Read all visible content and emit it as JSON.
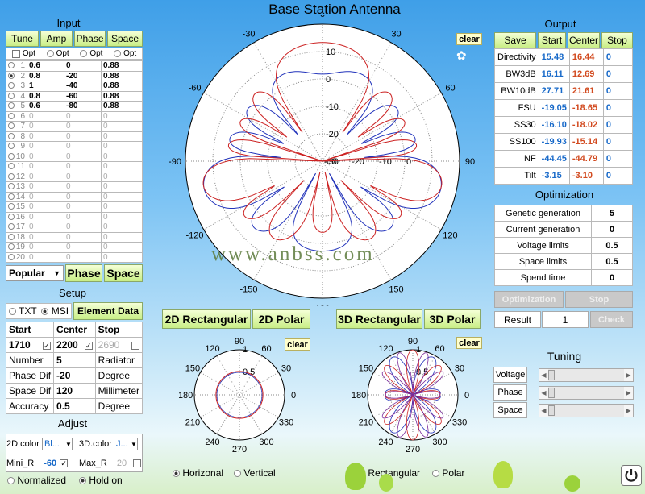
{
  "main_title": "Base Station Antenna",
  "watermark": "www.anbss.com",
  "input": {
    "title": "Input",
    "buttons": [
      "Tune",
      "Amp",
      "Phase",
      "Space"
    ],
    "opt_label": "Opt",
    "rows": [
      {
        "n": "1",
        "amp": "0.6",
        "phase": "0",
        "space": "0.88",
        "active": true
      },
      {
        "n": "2",
        "amp": "0.8",
        "phase": "-20",
        "space": "0.88",
        "active": true
      },
      {
        "n": "3",
        "amp": "1",
        "phase": "-40",
        "space": "0.88",
        "active": true
      },
      {
        "n": "4",
        "amp": "0.8",
        "phase": "-60",
        "space": "0.88",
        "active": true
      },
      {
        "n": "5",
        "amp": "0.6",
        "phase": "-80",
        "space": "0.88",
        "active": true
      },
      {
        "n": "6",
        "amp": "0",
        "phase": "0",
        "space": "0",
        "active": false
      },
      {
        "n": "7",
        "amp": "0",
        "phase": "0",
        "space": "0",
        "active": false
      },
      {
        "n": "8",
        "amp": "0",
        "phase": "0",
        "space": "0",
        "active": false
      },
      {
        "n": "9",
        "amp": "0",
        "phase": "0",
        "space": "0",
        "active": false
      },
      {
        "n": "10",
        "amp": "0",
        "phase": "0",
        "space": "0",
        "active": false
      },
      {
        "n": "11",
        "amp": "0",
        "phase": "0",
        "space": "0",
        "active": false
      },
      {
        "n": "12",
        "amp": "0",
        "phase": "0",
        "space": "0",
        "active": false
      },
      {
        "n": "13",
        "amp": "0",
        "phase": "0",
        "space": "0",
        "active": false
      },
      {
        "n": "14",
        "amp": "0",
        "phase": "0",
        "space": "0",
        "active": false
      },
      {
        "n": "15",
        "amp": "0",
        "phase": "0",
        "space": "0",
        "active": false
      },
      {
        "n": "16",
        "amp": "0",
        "phase": "0",
        "space": "0",
        "active": false
      },
      {
        "n": "17",
        "amp": "0",
        "phase": "0",
        "space": "0",
        "active": false
      },
      {
        "n": "18",
        "amp": "0",
        "phase": "0",
        "space": "0",
        "active": false
      },
      {
        "n": "19",
        "amp": "0",
        "phase": "0",
        "space": "0",
        "active": false
      },
      {
        "n": "20",
        "amp": "0",
        "phase": "0",
        "space": "0",
        "active": false
      }
    ],
    "preset": "Popular",
    "phase_btn": "Phase",
    "space_btn": "Space"
  },
  "setup": {
    "title": "Setup",
    "txt": "TXT",
    "msi": "MSI",
    "element_data": "Element Data",
    "headers": [
      "Start",
      "Center",
      "Stop"
    ],
    "freq": [
      "1710",
      "2200",
      "2690"
    ],
    "params": [
      {
        "label": "Number",
        "value": "5",
        "unit": "Radiator"
      },
      {
        "label": "Phase Dif",
        "value": "-20",
        "unit": "Degree"
      },
      {
        "label": "Space Dif",
        "value": "120",
        "unit": "Millimeter"
      },
      {
        "label": "Accuracy",
        "value": "0.5",
        "unit": "Degree"
      }
    ]
  },
  "adjust": {
    "title": "Adjust",
    "color2d_label": "2D.color",
    "color2d": "Bl...",
    "color3d_label": "3D.color",
    "color3d": "J...",
    "mini_label": "Mini_R",
    "mini": "-60",
    "max_label": "Max_R",
    "max": "20",
    "normalized": "Normalized",
    "hold": "Hold on"
  },
  "main_polar": {
    "clear": "clear",
    "angles": [
      "0",
      "30",
      "60",
      "90",
      "120",
      "150",
      "180",
      "-150",
      "-120",
      "-90",
      "-60",
      "-30"
    ],
    "radial": [
      "10",
      "0",
      "-10",
      "-20",
      "-30"
    ]
  },
  "views": {
    "rect2d": "2D Rectangular",
    "polar2d": "2D Polar",
    "rect3d": "3D Rectangular",
    "polar3d": "3D Polar"
  },
  "small_polar": {
    "clear": "clear",
    "angles": [
      "90",
      "60",
      "30",
      "0",
      "330",
      "300",
      "270",
      "240",
      "210",
      "180",
      "150",
      "120"
    ],
    "radial": [
      "1",
      "0.5"
    ]
  },
  "bottom": {
    "horizonal": "Horizonal",
    "vertical": "Vertical",
    "rectangular": "Rectangular",
    "polar": "Polar"
  },
  "output": {
    "title": "Output",
    "buttons": [
      "Save",
      "Start",
      "Center",
      "Stop"
    ],
    "rows": [
      {
        "label": "Directivity",
        "start": "15.48",
        "center": "16.44",
        "stop": "0"
      },
      {
        "label": "BW3dB",
        "start": "16.11",
        "center": "12.69",
        "stop": "0"
      },
      {
        "label": "BW10dB",
        "start": "27.71",
        "center": "21.61",
        "stop": "0"
      },
      {
        "label": "FSU",
        "start": "-19.05",
        "center": "-18.65",
        "stop": "0"
      },
      {
        "label": "SS30",
        "start": "-16.10",
        "center": "-18.02",
        "stop": "0"
      },
      {
        "label": "SS100",
        "start": "-19.93",
        "center": "-15.14",
        "stop": "0"
      },
      {
        "label": "NF",
        "start": "-44.45",
        "center": "-44.79",
        "stop": "0"
      },
      {
        "label": "Tilt",
        "start": "-3.15",
        "center": "-3.10",
        "stop": "0"
      }
    ]
  },
  "optimization": {
    "title": "Optimization",
    "rows": [
      {
        "label": "Genetic generation",
        "value": "5"
      },
      {
        "label": "Current generation",
        "value": "0"
      },
      {
        "label": "Voltage limits",
        "value": "0.5"
      },
      {
        "label": "Space limits",
        "value": "0.5"
      },
      {
        "label": "Spend time",
        "value": "0"
      }
    ],
    "optimization_btn": "Optimization",
    "stop_btn": "Stop",
    "result_label": "Result",
    "result": "1",
    "check_btn": "Check"
  },
  "tuning": {
    "title": "Tuning",
    "labels": [
      "Voltage",
      "Phase",
      "Space"
    ]
  },
  "colors": {
    "start_series": "#2233bb",
    "center_series": "#cc2222",
    "button": "#c9ee86",
    "output_start": "#1769c9",
    "output_center": "#d24a1f"
  }
}
